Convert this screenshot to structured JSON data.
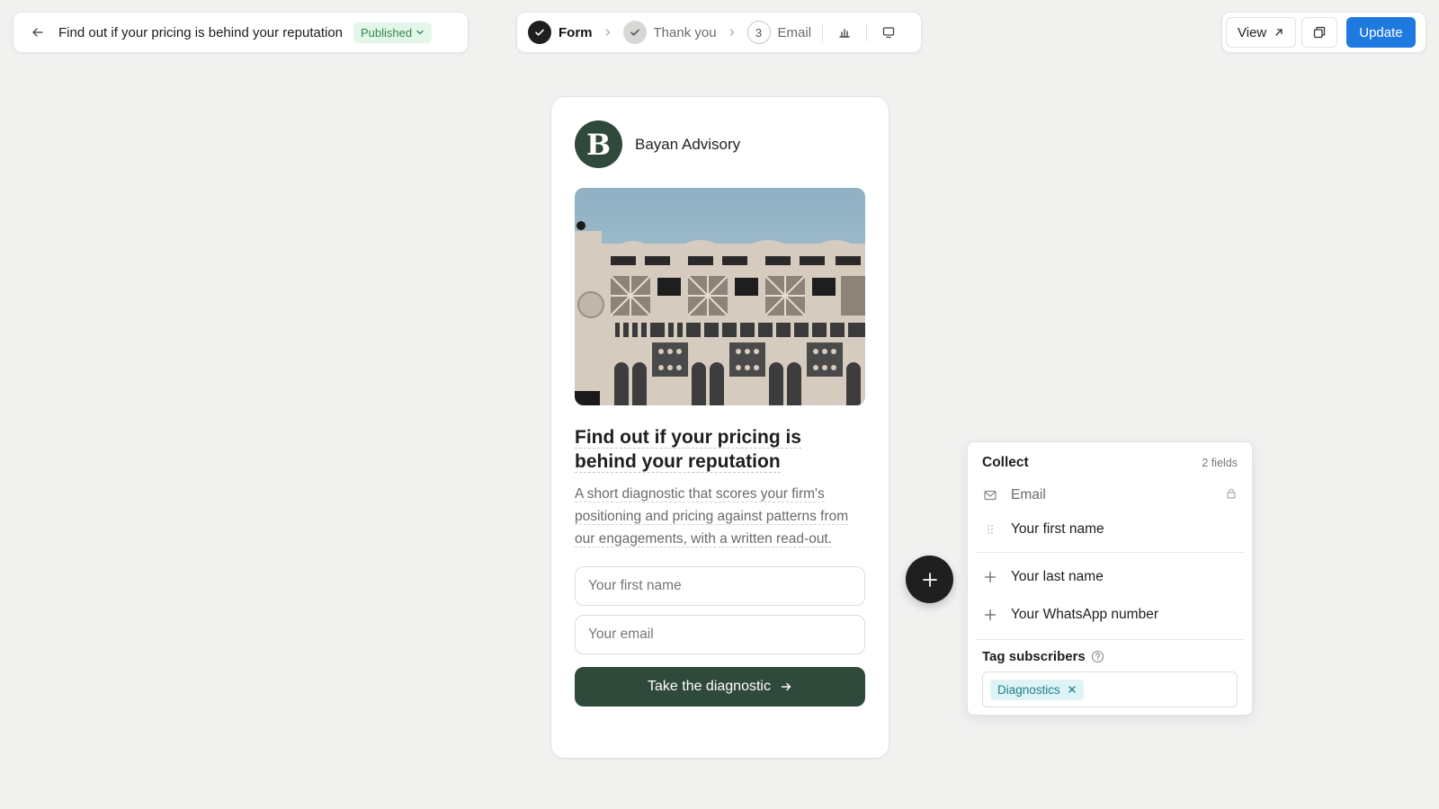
{
  "header": {
    "title": "Find out if your pricing is behind your reputation",
    "status": "Published"
  },
  "stepper": {
    "steps": [
      {
        "label": "Form",
        "state": "done"
      },
      {
        "label": "Thank you",
        "state": "done"
      },
      {
        "label": "Email",
        "number": "3"
      }
    ]
  },
  "actions": {
    "view_label": "View",
    "update_label": "Update"
  },
  "form": {
    "brand_initial": "B",
    "brand_name": "Bayan Advisory",
    "title": "Find out if your pricing is behind your reputation",
    "description": "A short diagnostic that scores your firm's positioning and pricing against patterns from our engagements, with a written read-out.",
    "fields": {
      "first_name_placeholder": "Your first name",
      "email_placeholder": "Your email"
    },
    "submit_label": "Take the diagnostic"
  },
  "collect": {
    "title": "Collect",
    "count": "2 fields",
    "active_fields": [
      "Email",
      "Your first name"
    ],
    "available_fields": [
      "Your last name",
      "Your WhatsApp number"
    ],
    "tag_label": "Tag subscribers",
    "tags": [
      "Diagnostics"
    ]
  },
  "colors": {
    "accent": "#1f7ae0",
    "brand": "#2f4a3a",
    "published_bg": "#e3f6e8",
    "published_text": "#2f8a4a",
    "tag_bg": "#ddf3f5"
  }
}
